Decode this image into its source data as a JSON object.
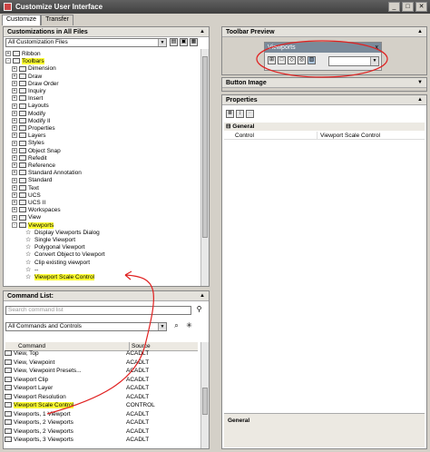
{
  "window": {
    "title": "Customize User Interface",
    "minimize": "_",
    "maximize": "□",
    "close": "✕"
  },
  "tabs": [
    {
      "label": "Customize"
    },
    {
      "label": "Transfer"
    }
  ],
  "customizations": {
    "header": "Customizations in All Files",
    "file_combo": "All Customization Files",
    "tree": [
      {
        "label": "Ribbon",
        "expander": "+",
        "icon": "folder-icon",
        "indent": 1,
        "highlight": false
      },
      {
        "label": "Toolbars",
        "expander": "-",
        "icon": "folder-icon",
        "indent": 1,
        "highlight": true
      },
      {
        "label": "Dimension",
        "expander": "+",
        "icon": "toolbar-icon",
        "indent": 2,
        "highlight": false
      },
      {
        "label": "Draw",
        "expander": "+",
        "icon": "toolbar-icon",
        "indent": 2,
        "highlight": false
      },
      {
        "label": "Draw Order",
        "expander": "+",
        "icon": "toolbar-icon",
        "indent": 2,
        "highlight": false
      },
      {
        "label": "Inquiry",
        "expander": "+",
        "icon": "toolbar-icon",
        "indent": 2,
        "highlight": false
      },
      {
        "label": "Insert",
        "expander": "+",
        "icon": "toolbar-icon",
        "indent": 2,
        "highlight": false
      },
      {
        "label": "Layouts",
        "expander": "+",
        "icon": "toolbar-icon",
        "indent": 2,
        "highlight": false
      },
      {
        "label": "Modify",
        "expander": "+",
        "icon": "toolbar-icon",
        "indent": 2,
        "highlight": false
      },
      {
        "label": "Modify II",
        "expander": "+",
        "icon": "toolbar-icon",
        "indent": 2,
        "highlight": false
      },
      {
        "label": "Properties",
        "expander": "+",
        "icon": "toolbar-icon",
        "indent": 2,
        "highlight": false
      },
      {
        "label": "Layers",
        "expander": "+",
        "icon": "toolbar-icon",
        "indent": 2,
        "highlight": false
      },
      {
        "label": "Styles",
        "expander": "+",
        "icon": "toolbar-icon",
        "indent": 2,
        "highlight": false
      },
      {
        "label": "Object Snap",
        "expander": "+",
        "icon": "toolbar-icon",
        "indent": 2,
        "highlight": false
      },
      {
        "label": "Refedit",
        "expander": "+",
        "icon": "toolbar-icon",
        "indent": 2,
        "highlight": false
      },
      {
        "label": "Reference",
        "expander": "+",
        "icon": "toolbar-icon",
        "indent": 2,
        "highlight": false
      },
      {
        "label": "Standard Annotation",
        "expander": "+",
        "icon": "toolbar-icon",
        "indent": 2,
        "highlight": false
      },
      {
        "label": "Standard",
        "expander": "+",
        "icon": "toolbar-icon",
        "indent": 2,
        "highlight": false
      },
      {
        "label": "Text",
        "expander": "+",
        "icon": "toolbar-icon",
        "indent": 2,
        "highlight": false
      },
      {
        "label": "UCS",
        "expander": "+",
        "icon": "toolbar-icon",
        "indent": 2,
        "highlight": false
      },
      {
        "label": "UCS II",
        "expander": "+",
        "icon": "toolbar-icon",
        "indent": 2,
        "highlight": false
      },
      {
        "label": "Workspaces",
        "expander": "+",
        "icon": "toolbar-icon",
        "indent": 2,
        "highlight": false
      },
      {
        "label": "View",
        "expander": "+",
        "icon": "toolbar-icon",
        "indent": 2,
        "highlight": false
      },
      {
        "label": "Viewports",
        "expander": "-",
        "icon": "toolbar-icon",
        "indent": 2,
        "highlight": true
      },
      {
        "label": "Display Viewports Dialog",
        "expander": "",
        "icon": "star-icon",
        "indent": 3,
        "highlight": false
      },
      {
        "label": "Single Viewport",
        "expander": "",
        "icon": "star-icon",
        "indent": 3,
        "highlight": false
      },
      {
        "label": "Polygonal Viewport",
        "expander": "",
        "icon": "star-icon",
        "indent": 3,
        "highlight": false
      },
      {
        "label": "Convert Object to Viewport",
        "expander": "",
        "icon": "star-icon",
        "indent": 3,
        "highlight": false
      },
      {
        "label": "Clip existing viewport",
        "expander": "",
        "icon": "star-icon",
        "indent": 3,
        "highlight": false
      },
      {
        "label": "--",
        "expander": "",
        "icon": "star-icon",
        "indent": 3,
        "highlight": false
      },
      {
        "label": "Viewport Scale Control",
        "expander": "",
        "icon": "star-icon",
        "indent": 3,
        "highlight": true
      }
    ]
  },
  "command_list": {
    "header": "Command List:",
    "search_placeholder": "Search command list",
    "filter_combo": "All Commands and Controls",
    "columns": {
      "command": "Command",
      "source": "Source"
    },
    "rows": [
      {
        "command": "View, Top",
        "source": "ACADLT",
        "highlight": false
      },
      {
        "command": "View, Viewpoint",
        "source": "ACADLT",
        "highlight": false
      },
      {
        "command": "View, Viewpoint Presets...",
        "source": "ACADLT",
        "highlight": false
      },
      {
        "command": "Viewport Clip",
        "source": "ACADLT",
        "highlight": false
      },
      {
        "command": "Viewport Layer",
        "source": "ACADLT",
        "highlight": false
      },
      {
        "command": "Viewport Resolution",
        "source": "ACADLT",
        "highlight": false
      },
      {
        "command": "Viewport Scale Control",
        "source": "CONTROL",
        "highlight": true
      },
      {
        "command": "Viewports, 1 Viewport",
        "source": "ACADLT",
        "highlight": false
      },
      {
        "command": "Viewports, 2 Viewports",
        "source": "ACADLT",
        "highlight": false
      },
      {
        "command": "Viewports, 2 Viewports",
        "source": "ACADLT",
        "highlight": false
      },
      {
        "command": "Viewports, 3 Viewports",
        "source": "ACADLT",
        "highlight": false
      }
    ]
  },
  "toolbar_preview": {
    "header": "Toolbar Preview",
    "toolbar_title": "Viewports",
    "close": "x"
  },
  "button_image": {
    "header": "Button Image"
  },
  "properties": {
    "header": "Properties",
    "category": "General",
    "rows": [
      {
        "name": "Control",
        "value": "Viewport Scale Control"
      }
    ],
    "footer": "General"
  },
  "colors": {
    "highlight": "#ffff33",
    "annotation": "#e02020"
  }
}
